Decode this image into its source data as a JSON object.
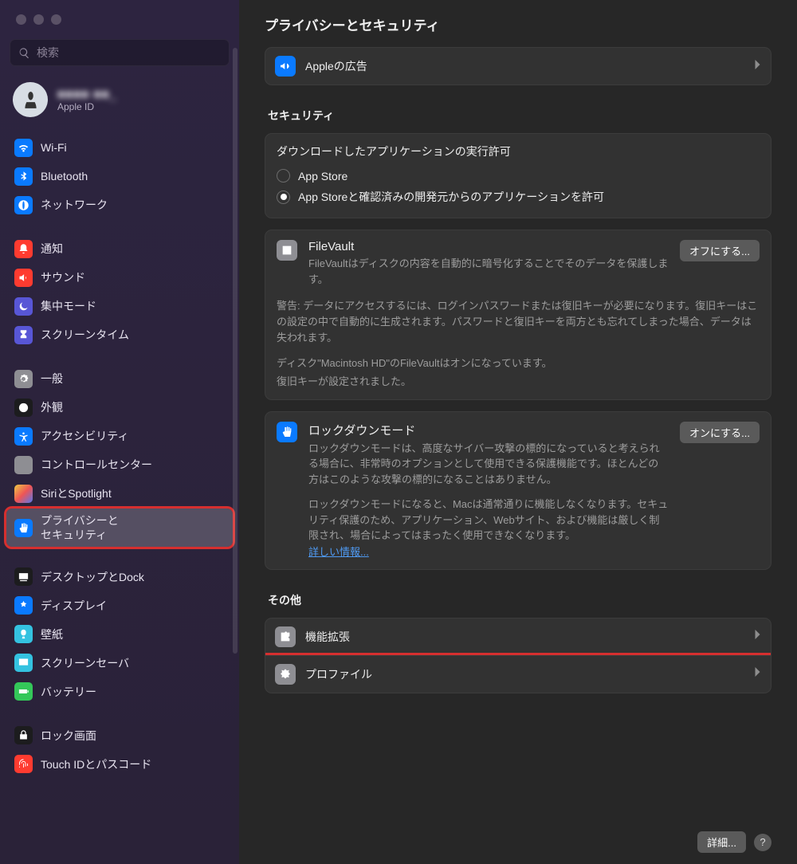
{
  "search": {
    "placeholder": "検索"
  },
  "account": {
    "name": "■■■■  ■■_",
    "sub": "Apple ID"
  },
  "sidebar": {
    "groups": [
      [
        {
          "label": "Wi-Fi",
          "icon": "wifi",
          "bg": "#0a7aff"
        },
        {
          "label": "Bluetooth",
          "icon": "bluetooth",
          "bg": "#0a7aff"
        },
        {
          "label": "ネットワーク",
          "icon": "network",
          "bg": "#0a7aff"
        }
      ],
      [
        {
          "label": "通知",
          "icon": "bell",
          "bg": "#ff3b30"
        },
        {
          "label": "サウンド",
          "icon": "speaker",
          "bg": "#ff3b30"
        },
        {
          "label": "集中モード",
          "icon": "moon",
          "bg": "#5856d6"
        },
        {
          "label": "スクリーンタイム",
          "icon": "hourglass",
          "bg": "#5856d6"
        }
      ],
      [
        {
          "label": "一般",
          "icon": "gear",
          "bg": "#8e8e93"
        },
        {
          "label": "外観",
          "icon": "appearance",
          "bg": "#1c1c1e"
        },
        {
          "label": "アクセシビリティ",
          "icon": "accessibility",
          "bg": "#0a7aff"
        },
        {
          "label": "コントロールセンター",
          "icon": "sliders",
          "bg": "#8e8e93"
        },
        {
          "label": "SiriとSpotlight",
          "icon": "siri",
          "bg": "#1c1c1e"
        },
        {
          "label": "プライバシーと\nセキュリティ",
          "icon": "hand",
          "bg": "#0a7aff",
          "active": true,
          "highlight": true
        }
      ],
      [
        {
          "label": "デスクトップとDock",
          "icon": "dock",
          "bg": "#1c1c1e"
        },
        {
          "label": "ディスプレイ",
          "icon": "display",
          "bg": "#0a7aff"
        },
        {
          "label": "壁紙",
          "icon": "wallpaper",
          "bg": "#34c2e0"
        },
        {
          "label": "スクリーンセーバ",
          "icon": "screensaver",
          "bg": "#34c2e0"
        },
        {
          "label": "バッテリー",
          "icon": "battery",
          "bg": "#34c759"
        }
      ],
      [
        {
          "label": "ロック画面",
          "icon": "lock",
          "bg": "#1c1c1e"
        },
        {
          "label": "Touch IDとパスコード",
          "icon": "fingerprint",
          "bg": "#ff3b30"
        }
      ]
    ]
  },
  "main": {
    "title": "プライバシーとセキュリティ",
    "apple_ads": "Appleの広告",
    "security_section": "セキュリティ",
    "gatekeeper": {
      "heading": "ダウンロードしたアプリケーションの実行許可",
      "opt1": "App Store",
      "opt2": "App Storeと確認済みの開発元からのアプリケーションを許可"
    },
    "filevault": {
      "title": "FileVault",
      "desc": "FileVaultはディスクの内容を自動的に暗号化することでそのデータを保護します。",
      "button": "オフにする...",
      "warn": "警告: データにアクセスするには、ログインパスワードまたは復旧キーが必要になります。復旧キーはこの設定の中で自動的に生成されます。パスワードと復旧キーを両方とも忘れてしまった場合、データは失われます。",
      "status1": "ディスク\"Macintosh HD\"のFileVaultはオンになっています。",
      "status2": "復旧キーが設定されました。"
    },
    "lockdown": {
      "title": "ロックダウンモード",
      "desc": "ロックダウンモードは、高度なサイバー攻撃の標的になっていると考えられる場合に、非常時のオプションとして使用できる保護機能です。ほとんどの方はこのような攻撃の標的になることはありません。",
      "desc2": "ロックダウンモードになると、Macは通常通りに機能しなくなります。セキュリティ保護のため、アプリケーション、Webサイト、および機能は厳しく制限され、場合によってはまったく使用できなくなります。",
      "link": "詳しい情報...",
      "button": "オンにする..."
    },
    "other_section": "その他",
    "extensions": "機能拡張",
    "profiles": "プロファイル",
    "details_btn": "詳細...",
    "help": "?"
  }
}
